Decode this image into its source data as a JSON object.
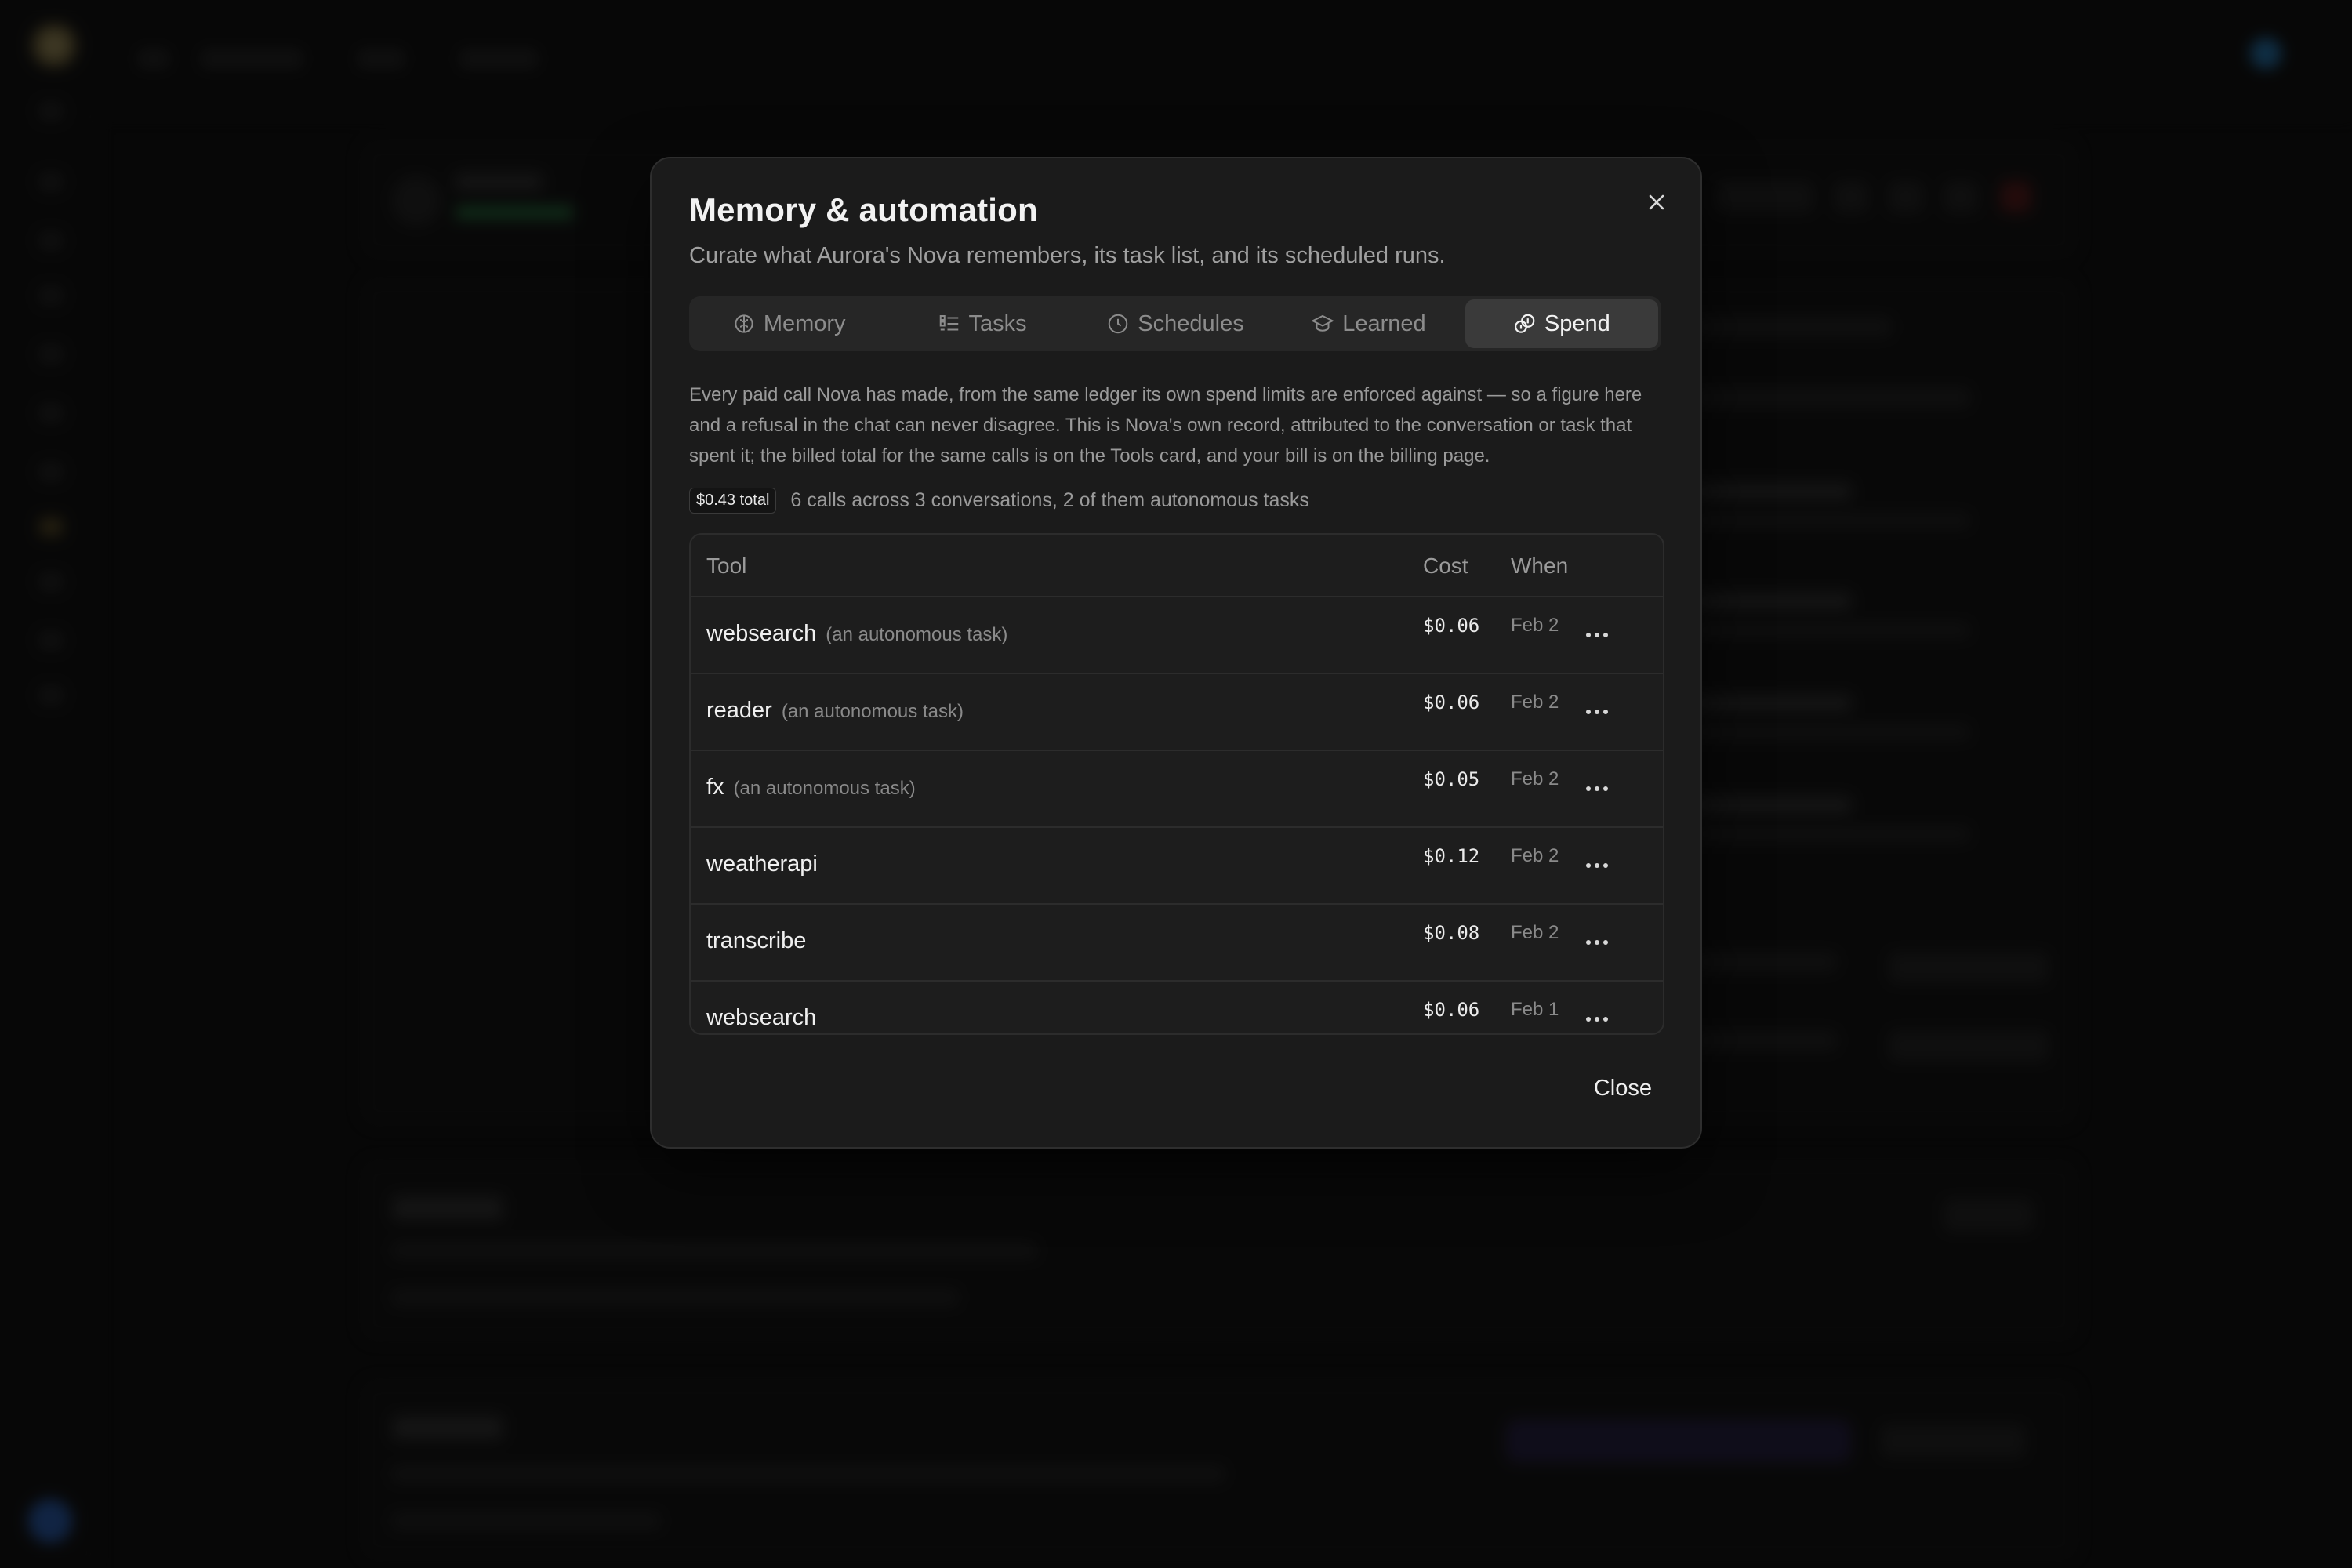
{
  "modal": {
    "title": "Memory & automation",
    "subtitle": "Curate what Aurora's Nova remembers, its task list, and its scheduled runs.",
    "tabs": [
      {
        "label": "Memory",
        "icon": "brain-icon"
      },
      {
        "label": "Tasks",
        "icon": "checklist-icon"
      },
      {
        "label": "Schedules",
        "icon": "clock-icon"
      },
      {
        "label": "Learned",
        "icon": "graduation-cap-icon"
      },
      {
        "label": "Spend",
        "icon": "coins-icon",
        "active": true
      }
    ],
    "description": "Every paid call Nova has made, from the same ledger its own spend limits are enforced against — so a figure here and a refusal in the chat can never disagree. This is Nova's own record, attributed to the conversation or task that spent it; the billed total for the same calls is on the Tools card, and your bill is on the billing page.",
    "summary": {
      "total_badge": "$0.43 total",
      "text": "6 calls across 3 conversations, 2 of them autonomous tasks"
    },
    "table": {
      "headers": {
        "tool": "Tool",
        "cost": "Cost",
        "when": "When"
      },
      "rows": [
        {
          "tool": "websearch",
          "note": "(an autonomous task)",
          "cost": "$0.06",
          "when": "Feb 2"
        },
        {
          "tool": "reader",
          "note": "(an autonomous task)",
          "cost": "$0.06",
          "when": "Feb 2"
        },
        {
          "tool": "fx",
          "note": "(an autonomous task)",
          "cost": "$0.05",
          "when": "Feb 2"
        },
        {
          "tool": "weatherapi",
          "note": "",
          "cost": "$0.12",
          "when": "Feb 2"
        },
        {
          "tool": "transcribe",
          "note": "",
          "cost": "$0.08",
          "when": "Feb 2"
        },
        {
          "tool": "websearch",
          "note": "",
          "cost": "$0.06",
          "when": "Feb 1"
        }
      ]
    },
    "close_label": "Close"
  },
  "colors": {
    "modal_bg": "#1b1b1b",
    "active_tab": "#3a3a3a",
    "muted_text": "#9a9a9a"
  }
}
